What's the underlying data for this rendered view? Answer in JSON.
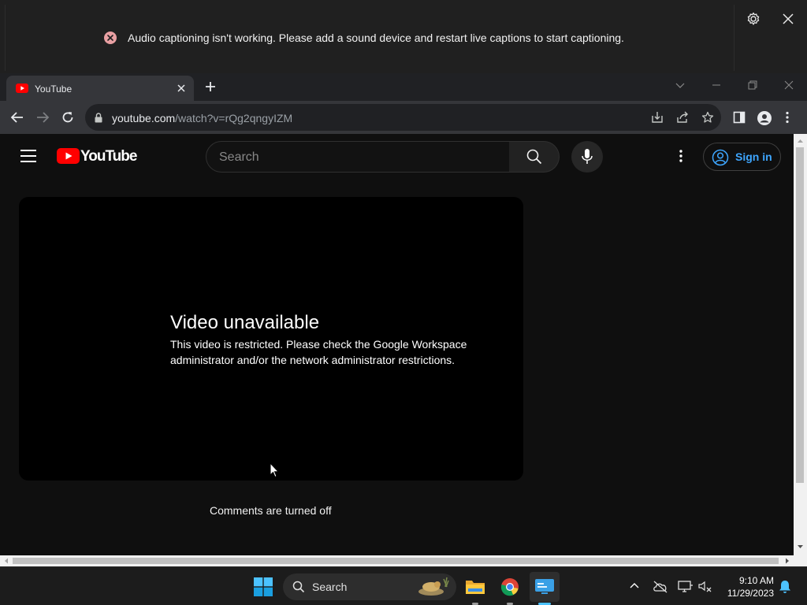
{
  "live_captions": {
    "message": "Audio captioning isn't working. Please add a sound device and restart live captions to start captioning.",
    "error_color": "#e9a0a3"
  },
  "browser": {
    "tab": {
      "title": "YouTube",
      "favicon": "youtube-icon"
    },
    "address": {
      "host": "youtube.com",
      "path": "/watch?v=rQg2qngyIZM"
    }
  },
  "youtube": {
    "logo_text": "YouTube",
    "search_placeholder": "Search",
    "sign_in_label": "Sign in",
    "player": {
      "heading": "Video unavailable",
      "message": "This video is restricted. Please check the Google Workspace administrator and/or the network administrator restrictions."
    },
    "comments_status": "Comments are turned off"
  },
  "taskbar": {
    "search_label": "Search",
    "time": "9:10 AM",
    "date": "11/29/2023",
    "apps": [
      "start-icon",
      "file-explorer-icon",
      "chrome-icon",
      "remote-desktop-icon"
    ]
  },
  "colors": {
    "accent_blue": "#3ea6ff",
    "youtube_red": "#ff0000",
    "windows_blue": "#4cc2ff"
  }
}
